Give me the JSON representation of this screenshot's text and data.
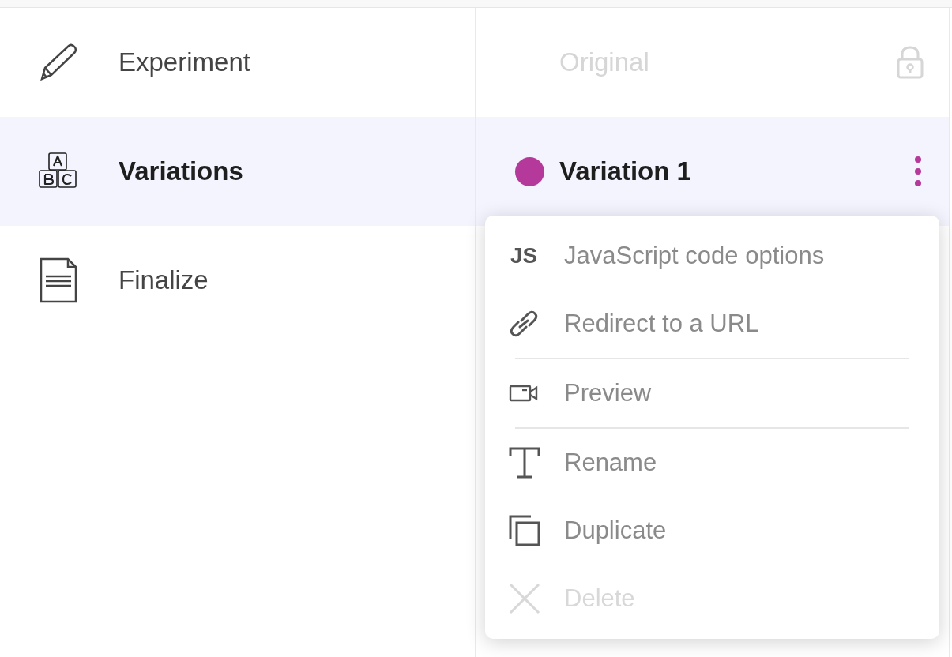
{
  "steps": [
    {
      "label": "Experiment",
      "selected": false
    },
    {
      "label": "Variations",
      "selected": true
    },
    {
      "label": "Finalize",
      "selected": false
    }
  ],
  "variations": [
    {
      "kind": "original",
      "name": "Original",
      "locked": true,
      "selected": false
    },
    {
      "kind": "variation",
      "name": "Variation 1",
      "color": "#b5399a",
      "selected": true
    }
  ],
  "menu": [
    {
      "kind": "item",
      "icon_text": "JS",
      "label": "JavaScript code options",
      "disabled": false
    },
    {
      "kind": "item",
      "label": "Redirect to a URL",
      "disabled": false
    },
    {
      "kind": "divider"
    },
    {
      "kind": "item",
      "label": "Preview",
      "disabled": false
    },
    {
      "kind": "divider"
    },
    {
      "kind": "item",
      "label": "Rename",
      "disabled": false
    },
    {
      "kind": "item",
      "label": "Duplicate",
      "disabled": false
    },
    {
      "kind": "item",
      "label": "Delete",
      "disabled": true
    }
  ]
}
